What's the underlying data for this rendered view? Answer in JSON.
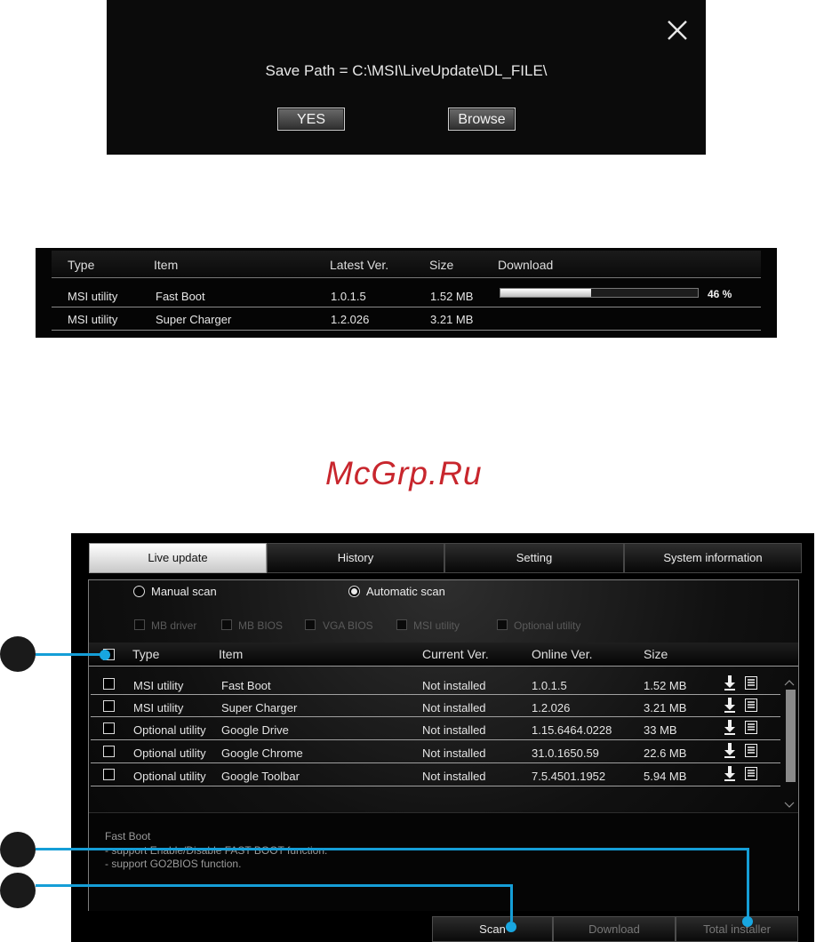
{
  "dialog": {
    "save_path": "Save Path = C:\\MSI\\LiveUpdate\\DL_FILE\\",
    "yes_label": "YES",
    "browse_label": "Browse",
    "close_icon": "close-icon"
  },
  "download_table": {
    "headers": [
      "Type",
      "Item",
      "Latest Ver.",
      "Size",
      "Download"
    ],
    "rows": [
      {
        "type": "MSI utility",
        "item": "Fast Boot",
        "version": "1.0.1.5",
        "size": "1.52 MB",
        "progress_percent": 46,
        "progress_label": "46 %"
      },
      {
        "type": "MSI utility",
        "item": "Super Charger",
        "version": "1.2.026",
        "size": "3.21 MB"
      }
    ]
  },
  "watermark": "McGrp.Ru",
  "window": {
    "tabs": [
      "Live update",
      "History",
      "Setting",
      "System information"
    ],
    "active_tab": "Live update",
    "scan_modes": {
      "manual": "Manual scan",
      "automatic": "Automatic scan",
      "selected": "automatic"
    },
    "filters": [
      "MB driver",
      "MB BIOS",
      "VGA BIOS",
      "MSI utility",
      "Optional utility"
    ],
    "list_headers": [
      "Type",
      "Item",
      "Current Ver.",
      "Online Ver.",
      "Size"
    ],
    "rows": [
      {
        "type": "MSI utility",
        "item": "Fast Boot",
        "current": "Not installed",
        "online": "1.0.1.5",
        "size": "1.52 MB"
      },
      {
        "type": "MSI utility",
        "item": "Super Charger",
        "current": "Not installed",
        "online": "1.2.026",
        "size": "3.21 MB"
      },
      {
        "type": "Optional utility",
        "item": "Google Drive",
        "current": "Not installed",
        "online": "1.15.6464.0228",
        "size": "33 MB"
      },
      {
        "type": "Optional utility",
        "item": "Google Chrome",
        "current": "Not installed",
        "online": "31.0.1650.59",
        "size": "22.6 MB"
      },
      {
        "type": "Optional utility",
        "item": "Google Toolbar",
        "current": "Not installed",
        "online": "7.5.4501.1952",
        "size": "5.94 MB"
      }
    ],
    "row_icons": [
      "download-arrow-icon",
      "release-note-icon"
    ],
    "description": {
      "title": "Fast Boot",
      "lines": [
        "- support Enable/Disable FAST BOOT function.",
        "- support GO2BIOS function."
      ]
    },
    "buttons": {
      "scan": "Scan",
      "download": "Download",
      "total_installer": "Total installer"
    }
  },
  "colors": {
    "callout_line": "#159ed7",
    "watermark": "#c8262d",
    "background": "#000000"
  }
}
